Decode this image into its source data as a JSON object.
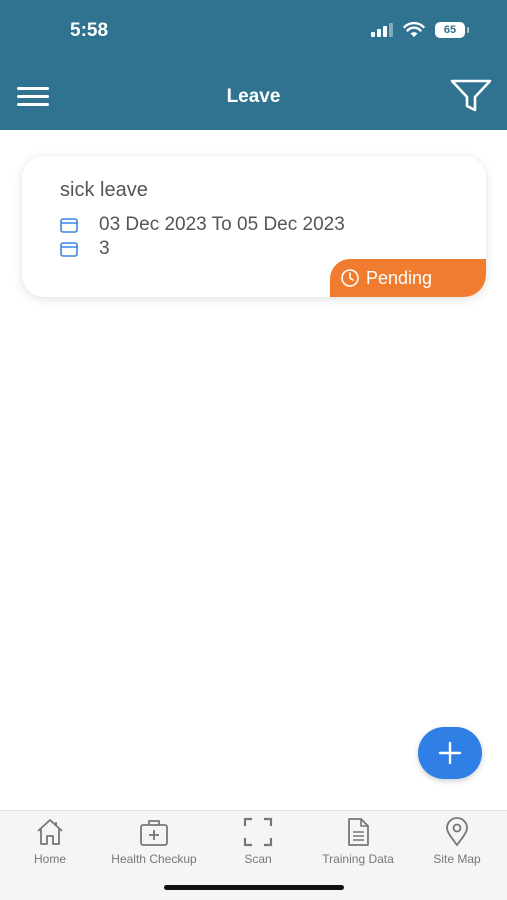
{
  "status_bar": {
    "time": "5:58",
    "battery": "65"
  },
  "header": {
    "title": "Leave"
  },
  "leave_card": {
    "title": "sick leave",
    "date_range": "03 Dec 2023 To 05 Dec 2023",
    "days": "3",
    "status": "Pending",
    "status_color": "#ef7c2f"
  },
  "bottom_nav": {
    "items": [
      {
        "label": "Home",
        "icon": "home-icon"
      },
      {
        "label": "Health Checkup",
        "icon": "medical-kit-icon"
      },
      {
        "label": "Scan",
        "icon": "scan-icon"
      },
      {
        "label": "Training Data",
        "icon": "document-icon"
      },
      {
        "label": "Site Map",
        "icon": "location-pin-icon"
      }
    ]
  },
  "colors": {
    "header": "#2f7390",
    "fab": "#2f7fe6",
    "badge": "#ef7c2f"
  }
}
